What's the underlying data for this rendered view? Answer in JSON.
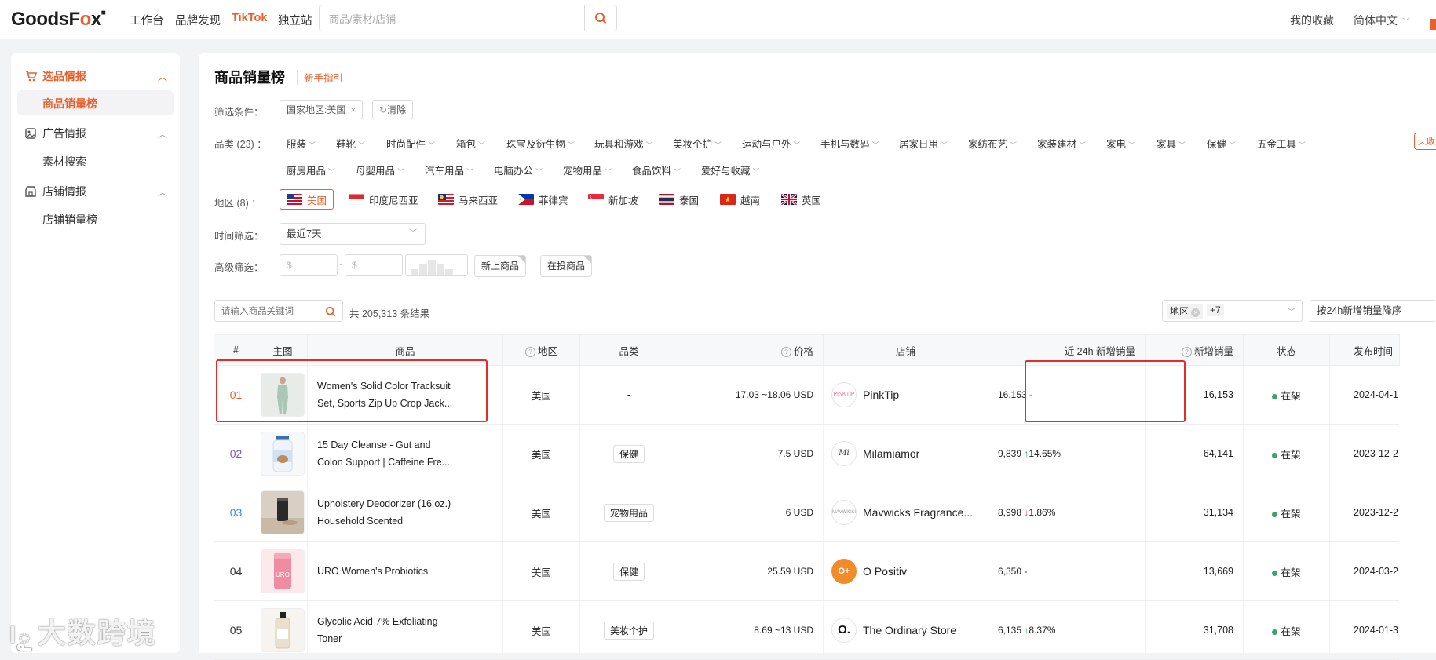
{
  "header": {
    "logo": {
      "part1": "GoodsF",
      "part2": "o",
      "part3": "x"
    },
    "nav": [
      "工作台",
      "品牌发现",
      "TikTok",
      "独立站"
    ],
    "search_placeholder": "商品/素材/店铺",
    "favorites": "我的收藏",
    "language": "简体中文",
    "accent_color": "#e8602c"
  },
  "sidebar": {
    "groups": [
      {
        "label": "选品情报",
        "icon": "cart-icon",
        "items": [
          "商品销量榜"
        ]
      },
      {
        "label": "广告情报",
        "icon": "ad-icon",
        "items": [
          "素材搜索"
        ]
      },
      {
        "label": "店铺情报",
        "icon": "store-icon",
        "items": [
          "店铺销量榜"
        ]
      }
    ]
  },
  "page": {
    "title": "商品销量榜",
    "guide": "新手指引",
    "filter_label": "筛选条件：",
    "active_filter": "国家地区:美国",
    "clear": "清除",
    "category_label": "品类 (23) ：",
    "categories": [
      "服装",
      "鞋靴",
      "时尚配件",
      "箱包",
      "珠宝及衍生物",
      "玩具和游戏",
      "美妆个护",
      "运动与户外",
      "手机与数码",
      "居家日用",
      "家纺布艺",
      "家装建材",
      "家电",
      "家具",
      "保健",
      "五金工具",
      "厨房用品",
      "母婴用品",
      "汽车用品",
      "电脑办公",
      "宠物用品",
      "食品饮料",
      "爱好与收藏"
    ],
    "collapse": "收",
    "region_label": "地区 (8) ：",
    "regions": [
      "美国",
      "印度尼西亚",
      "马来西亚",
      "菲律宾",
      "新加坡",
      "泰国",
      "越南",
      "英国"
    ],
    "time_label": "时间筛选：",
    "time_value": "最近7天",
    "advanced_label": "高级筛选：",
    "price_placeholder": "$",
    "price_sep": "-",
    "new_products": "新上商品",
    "in_ads": "在投商品",
    "keyword_placeholder": "请输入商品关键词",
    "result_count": "共 205,313 条结果",
    "region_filter": {
      "label": "地区",
      "more": "+7"
    },
    "sort": "按24h新增销量降序"
  },
  "table": {
    "headers": {
      "rank": "#",
      "image": "主图",
      "product": "商品",
      "region": "地区",
      "category": "品类",
      "price": "价格",
      "store": "店铺",
      "sales24h": "近 24h 新增销量",
      "total": "新增销量",
      "status": "状态",
      "date": "发布时间"
    },
    "rows": [
      {
        "rank": "01",
        "name1": "Women's Solid Color Tracksuit",
        "name2": "Set, Sports Zip Up Crop Jack...",
        "region": "美国",
        "category": "-",
        "price": "17.03 ~18.06 USD",
        "store": "PinkTip",
        "sales": "16,153",
        "change": "-",
        "trend": "none",
        "total": "16,153",
        "status": "在架",
        "date": "2024-04-1"
      },
      {
        "rank": "02",
        "name1": "15 Day Cleanse - Gut and",
        "name2": "Colon Support | Caffeine Fre...",
        "region": "美国",
        "category": "保健",
        "price": "7.5 USD",
        "store": "Milamiamor",
        "sales": "9,839",
        "change": "14.65%",
        "trend": "up",
        "total": "64,141",
        "status": "在架",
        "date": "2023-12-2"
      },
      {
        "rank": "03",
        "name1": "Upholstery Deodorizer (16 oz.)",
        "name2": "Household Scented",
        "region": "美国",
        "category": "宠物用品",
        "price": "6 USD",
        "store": "Mavwicks Fragrance...",
        "sales": "8,998",
        "change": "1.86%",
        "trend": "down",
        "total": "31,134",
        "status": "在架",
        "date": "2023-12-2"
      },
      {
        "rank": "04",
        "name1": "URO Women's Probiotics",
        "name2": "",
        "region": "美国",
        "category": "保健",
        "price": "25.59 USD",
        "store": "O Positiv",
        "sales": "6,350",
        "change": "-",
        "trend": "none",
        "total": "13,669",
        "status": "在架",
        "date": "2024-03-2"
      },
      {
        "rank": "05",
        "name1": "Glycolic Acid 7% Exfoliating",
        "name2": "Toner",
        "region": "美国",
        "category": "美妆个护",
        "price": "8.69 ~13 USD",
        "store": "The Ordinary Store",
        "sales": "6,135",
        "change": "8.37%",
        "trend": "up",
        "total": "31,708",
        "status": "在架",
        "date": "2024-01-3"
      }
    ]
  },
  "watermark": "大数跨境"
}
